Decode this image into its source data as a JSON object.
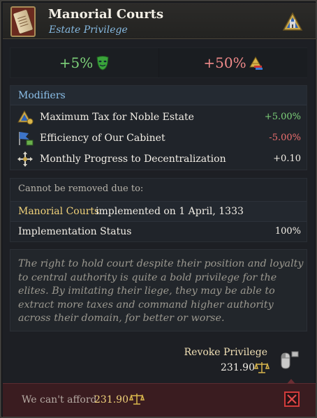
{
  "header": {
    "title": "Manorial Courts",
    "subtitle": "Estate Privilege",
    "icon": "scroll-icon",
    "estate_icon": "nobility-estate-icon"
  },
  "effects": {
    "left": {
      "value": "+5%",
      "icon": "green-mask-icon",
      "color": "#7ed37a"
    },
    "right": {
      "value": "+50%",
      "icon": "pyramid-power-icon",
      "color": "#f08a8a"
    }
  },
  "modifiers": {
    "title": "Modifiers",
    "rows": [
      {
        "label": "Maximum Tax for Noble Estate",
        "value": "+5.00%",
        "tone": "pos",
        "icon": "noble-tax-icon"
      },
      {
        "label": "Efficiency of Our Cabinet",
        "value": "-5.00%",
        "tone": "neg",
        "icon": "cabinet-flag-icon"
      },
      {
        "label": "Monthly Progress to Decentralization",
        "value": "+0.10",
        "tone": "neutral",
        "icon": "decentralization-arrows-icon"
      }
    ]
  },
  "removal": {
    "cannot_remove": "Cannot be removed due to:",
    "privilege_name": "Manorial Courts",
    "implemented_text": "implemented on 1 April, 1333",
    "status_label": "Implementation Status",
    "status_value": "100%"
  },
  "description": "The right to hold court despite their position and loyalty to central authority is quite a bold privilege for the elites. By imitating their liege, they may be able to extract more taxes and command higher authority across their domain, for better or worse.",
  "revoke": {
    "label": "Revoke Privilege",
    "cost": "231.90",
    "cost_icon": "scales-icon",
    "input_icon": "mouse-click-icon"
  },
  "footer": {
    "afford_label": "We can't afford",
    "afford_value": "231.90",
    "afford_icon": "scales-icon",
    "close_icon": "close-x-icon"
  }
}
